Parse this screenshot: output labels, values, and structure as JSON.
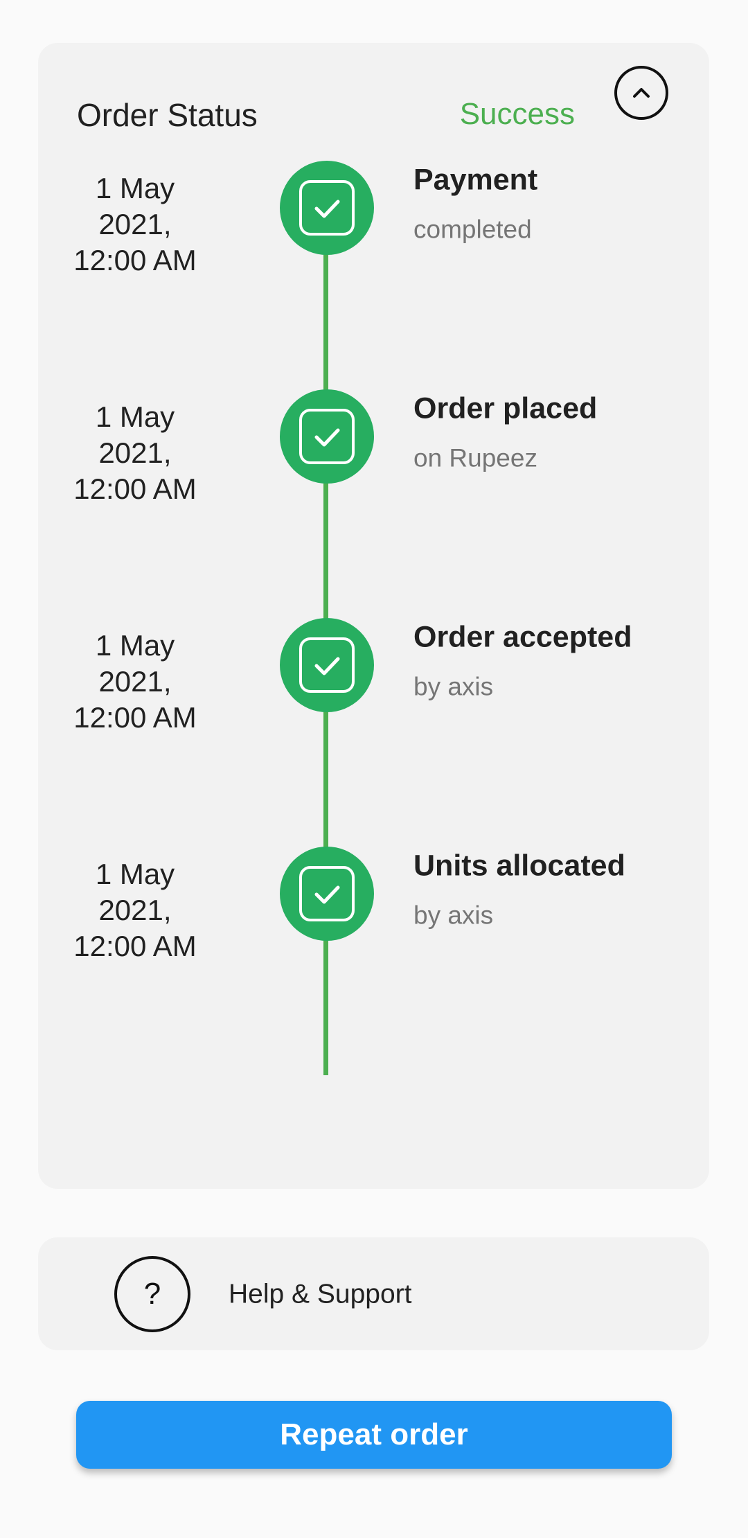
{
  "colors": {
    "success": "#4caf50",
    "badge": "#27ae60",
    "timeline": "#4caf50",
    "button": "#2196f3"
  },
  "order_status": {
    "title": "Order Status",
    "status": "Success",
    "collapse_icon": "chevron-up-icon"
  },
  "timeline": [
    {
      "date_line1": "1 May 2021,",
      "date_line2": "12:00 AM",
      "title": "Payment",
      "subtitle": "completed",
      "icon": "check-square-icon"
    },
    {
      "date_line1": "1 May 2021,",
      "date_line2": "12:00 AM",
      "title": "Order placed",
      "subtitle": "on Rupeez",
      "icon": "check-square-icon"
    },
    {
      "date_line1": "1 May 2021,",
      "date_line2": "12:00 AM",
      "title": "Order accepted",
      "subtitle": "by axis",
      "icon": "check-square-icon"
    },
    {
      "date_line1": "1 May 2021,",
      "date_line2": "12:00 AM",
      "title": "Units allocated",
      "subtitle": "by axis",
      "icon": "check-square-icon"
    }
  ],
  "help": {
    "icon": "question-icon",
    "icon_glyph": "?",
    "label": "Help & Support"
  },
  "repeat_button": {
    "label": "Repeat order"
  }
}
